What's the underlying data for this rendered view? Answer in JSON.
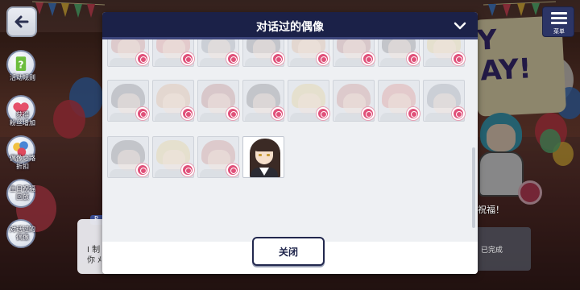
{
  "modal": {
    "title": "对话过的偶像",
    "close_label": "关闭",
    "collapse_icon": "chevron-down-icon"
  },
  "side_menu": [
    {
      "label": "活动规则",
      "icon": "question-icon"
    },
    {
      "label": "获得\n粉丝增加",
      "icon": "heart-plus-icon"
    },
    {
      "label": "偶像之路\n折扣",
      "icon": "balloon-icon"
    },
    {
      "label": "生日祝福\n回放",
      "icon": "replay-icon"
    },
    {
      "label": "对话过的\n偶像",
      "icon": "idol-icon"
    }
  ],
  "top_right": {
    "menu_label": "菜单",
    "menu_icon": "hamburger-icon"
  },
  "background": {
    "wish_text": "祝福！",
    "done_text": "已完成",
    "dialog_snippet": "I 制\n你 ﾒ"
  },
  "idols": {
    "rows": [
      {
        "count": 8,
        "partial": true
      },
      {
        "count": 8,
        "partial": false
      },
      {
        "count": 4,
        "partial": false
      }
    ],
    "highlighted_index": 3
  },
  "colors": {
    "header_bg": "#1b2148",
    "badge": "#e0517a",
    "modal_bg": "#eef0f3"
  }
}
